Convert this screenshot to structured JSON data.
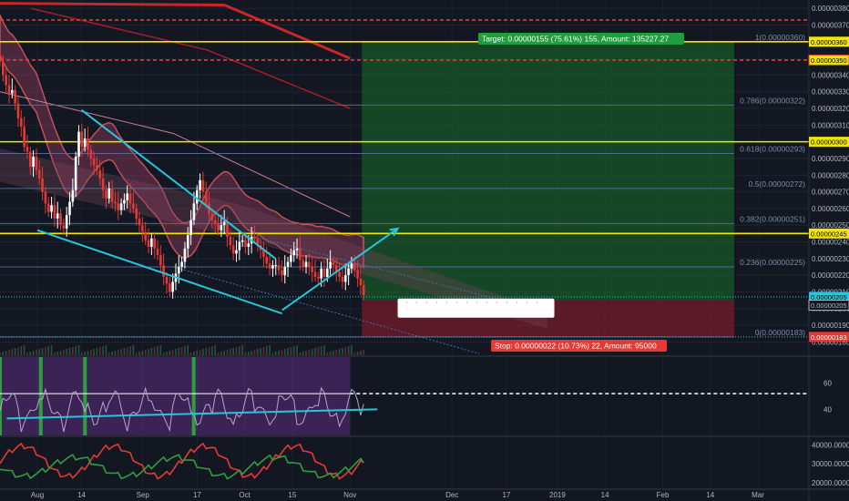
{
  "chart_data": {
    "type": "candlestick",
    "price_axis": {
      "ticks": [
        "0.00000380",
        "0.00000370",
        "0.00000360",
        "0.00000350",
        "0.00000340",
        "0.00000330",
        "0.00000320",
        "0.00000310",
        "0.00000300",
        "0.00000290",
        "0.00000280",
        "0.00000270",
        "0.00000260",
        "0.00000250",
        "0.00000240",
        "0.00000230",
        "0.00000220",
        "0.00000210",
        "0.00000200",
        "0.00000190",
        "0.00000180"
      ],
      "tick_values": [
        380,
        370,
        360,
        350,
        340,
        330,
        320,
        310,
        300,
        290,
        280,
        270,
        260,
        250,
        240,
        230,
        220,
        210,
        200,
        190,
        180
      ],
      "range": [
        172,
        385
      ]
    },
    "time_axis": {
      "labels": [
        "Aug",
        "14",
        "Sep",
        "17",
        "Oct",
        "15",
        "Nov",
        "Dec",
        "17",
        "2019",
        "14",
        "Feb",
        "14",
        "Mar"
      ],
      "label_days": [
        0,
        13,
        31,
        47,
        61,
        75,
        92,
        122,
        138,
        153,
        167,
        184,
        198,
        212
      ],
      "range_days": [
        -11,
        227
      ]
    },
    "price_tags": [
      {
        "text": "0.00000360",
        "value": 360,
        "bg": "#f0e600",
        "fg": "#000000"
      },
      {
        "text": "0.00000350",
        "value": 349,
        "bg": "#f0e600",
        "fg": "#000000",
        "outline": "#e53935"
      },
      {
        "text": "0.00000300",
        "value": 300,
        "bg": "#f0e600",
        "fg": "#000000"
      },
      {
        "text": "0.00000245",
        "value": 245,
        "bg": "#f0e600",
        "fg": "#000000"
      },
      {
        "text": "0.00000205",
        "value": 207,
        "bg": "#26c6da",
        "fg": "#000000"
      },
      {
        "text": "0.00000205",
        "value": 202,
        "bg": "#131722",
        "fg": "#b2b5be",
        "outline": "#b2b5be"
      },
      {
        "text": "0.00000183",
        "value": 183,
        "bg": "#e53935",
        "fg": "#ffffff"
      }
    ],
    "fib_levels": [
      {
        "label": "1(0.00000360)",
        "value": 360
      },
      {
        "label": "0.786(0.00000322)",
        "value": 322
      },
      {
        "label": "0.618(0.00000293)",
        "value": 293
      },
      {
        "label": "0.5(0.00000272)",
        "value": 272
      },
      {
        "label": "0.382(0.00000251)",
        "value": 251
      },
      {
        "label": "0.236(0.00000225)",
        "value": 225
      },
      {
        "label": "0(0.00000183)",
        "value": 183
      }
    ],
    "target_label": "Target: 0.00000155 (75.61%) 155, Amount: 135227.27",
    "stop_label": "Stop: 0.00000022 (10.73%) 22, Amount: 95000",
    "entry_value": 205,
    "target_value": 360,
    "stop_value": 183,
    "horizontal_lines": [
      {
        "value": 360,
        "color": "#f0e600",
        "style": "solid"
      },
      {
        "value": 300,
        "color": "#f0e600",
        "style": "solid"
      },
      {
        "value": 245,
        "color": "#f0e600",
        "style": "solid"
      },
      {
        "value": 373,
        "color": "#e53935",
        "style": "dashed"
      },
      {
        "value": 349,
        "color": "#e53935",
        "style": "dashed"
      }
    ],
    "trendlines": [
      {
        "from": [
          13,
          319
        ],
        "to": [
          70,
          230
        ],
        "color": "#26c6da"
      },
      {
        "from": [
          0,
          247
        ],
        "to": [
          72,
          197
        ],
        "color": "#26c6da"
      }
    ],
    "arrow": {
      "from": [
        72,
        199
      ],
      "to": [
        106,
        248
      ],
      "color": "#26c6da"
    },
    "close": [
      348,
      340,
      334,
      329,
      331,
      323,
      314,
      309,
      297,
      294,
      285,
      291,
      283,
      278,
      270,
      263,
      258,
      262,
      254,
      257,
      250,
      248,
      256,
      264,
      271,
      291,
      306,
      297,
      302,
      295,
      290,
      286,
      283,
      278,
      271,
      266,
      272,
      264,
      263,
      259,
      263,
      265,
      269,
      263,
      260,
      254,
      250,
      246,
      241,
      237,
      242,
      236,
      232,
      226,
      219,
      215,
      210,
      216,
      221,
      225,
      228,
      236,
      244,
      253,
      263,
      271,
      277,
      270,
      263,
      257,
      253,
      251,
      247,
      250,
      252,
      243,
      238,
      233,
      235,
      240,
      241,
      237,
      239,
      243,
      242,
      238,
      235,
      231,
      227,
      224,
      226,
      226,
      223,
      220,
      225,
      228,
      232,
      235,
      236,
      229,
      225,
      228,
      225,
      222,
      219,
      218,
      224,
      219,
      224,
      228,
      226,
      222,
      219,
      216,
      220,
      224,
      227,
      223,
      218,
      214,
      208
    ],
    "osc_axis": {
      "ticks": [
        "60",
        "40"
      ],
      "tick_values": [
        60,
        40
      ],
      "range": [
        20,
        80
      ]
    },
    "vol_axis": {
      "ticks": [
        "40000.0000",
        "30000.0000",
        "20000.0000"
      ],
      "tick_values": [
        40000,
        30000,
        20000
      ],
      "range": [
        17000,
        44000
      ]
    }
  }
}
